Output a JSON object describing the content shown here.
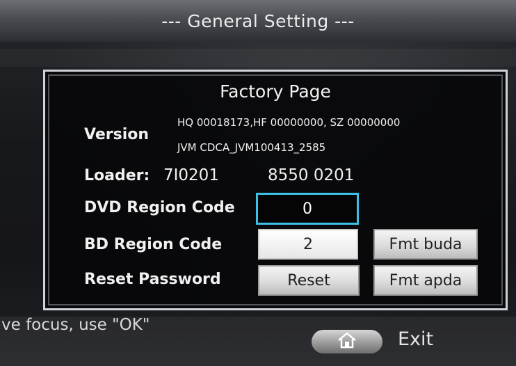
{
  "header": {
    "title": "--- General Setting ---"
  },
  "panel": {
    "title": "Factory Page",
    "version": {
      "label": "Version",
      "line1": "HQ 00018173,HF 00000000, SZ 00000000",
      "line2": "JVM CDCA_JVM100413_2585"
    },
    "loader": {
      "label": "Loader:",
      "value1": "7I0201",
      "value2": "8550 0201"
    },
    "dvd_region": {
      "label": "DVD Region Code",
      "value": "0"
    },
    "bd_region": {
      "label": "BD Region Code",
      "value": "2",
      "fmt_button": "Fmt buda"
    },
    "reset_password": {
      "label": "Reset Password",
      "reset_button": "Reset",
      "fmt_button": "Fmt apda"
    }
  },
  "footer": {
    "hint": "ve focus, use \"OK\"",
    "home_icon": "home-icon",
    "exit_label": "Exit"
  },
  "colors": {
    "focus_border": "#3cc0e6",
    "panel_border": "#cfd2d8",
    "text": "#f0f0f0"
  }
}
